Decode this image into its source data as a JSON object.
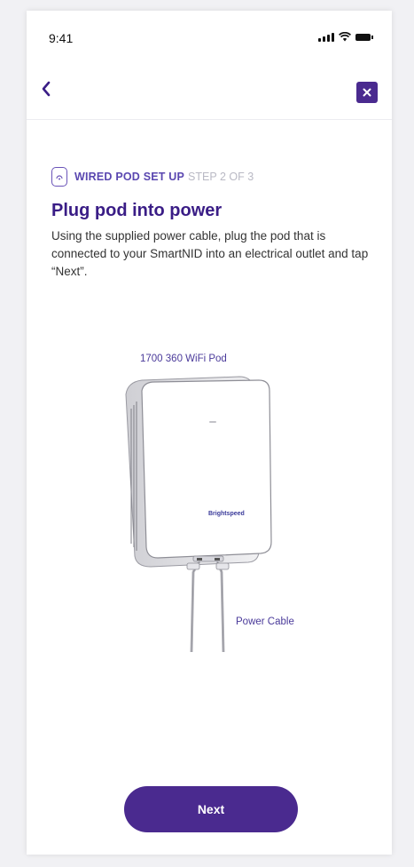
{
  "status_bar": {
    "time": "9:41"
  },
  "nav": {
    "back_icon": "chevron-left-icon",
    "close_icon": "close-icon"
  },
  "step": {
    "icon": "pod-icon",
    "label": "WIRED POD SET UP",
    "count": "STEP 2 OF 3"
  },
  "title": "Plug pod into power",
  "instructions": "Using the supplied power cable, plug the pod that is connected to your SmartNID into an electrical outlet and tap “Next”.",
  "figure": {
    "pod_caption": "1700 360 WiFi Pod",
    "cable_caption": "Power Cable"
  },
  "next_label": "Next",
  "colors": {
    "accent": "#4a2a8f",
    "title": "#3a1d86",
    "step_label": "#5a47b0",
    "step_count": "#b9b9c4"
  }
}
